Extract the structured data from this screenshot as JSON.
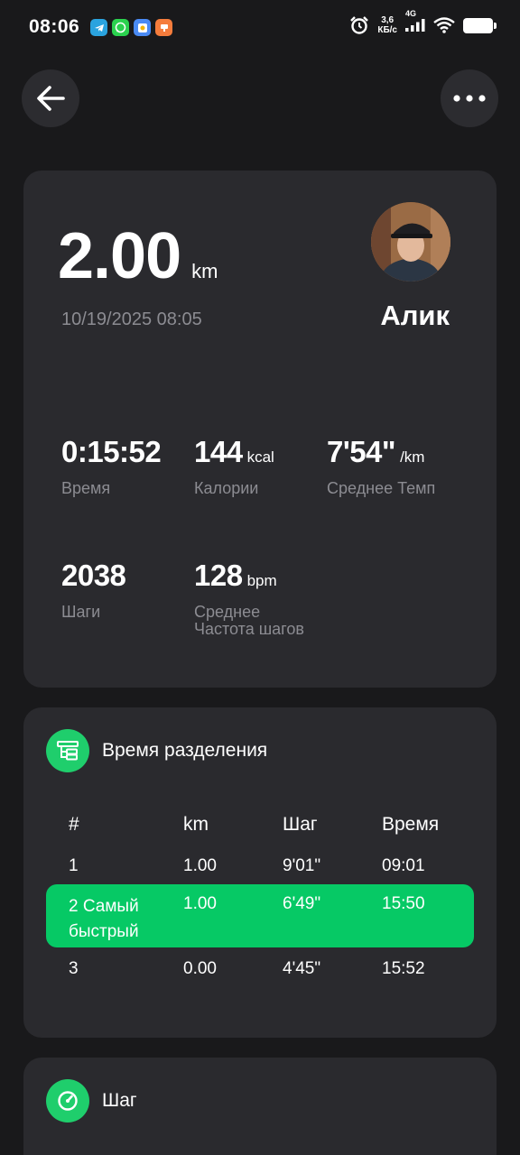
{
  "status_bar": {
    "time": "08:06",
    "net_speed_value": "3,6",
    "net_speed_unit": "КБ/с",
    "network_type": "4G"
  },
  "workout": {
    "distance": "2.00",
    "distance_unit": "km",
    "datetime": "10/19/2025 08:05",
    "user_name": "Алик"
  },
  "stats": {
    "time": {
      "value": "0:15:52",
      "label": "Время"
    },
    "calories": {
      "value": "144",
      "unit": "kcal",
      "label": "Калории"
    },
    "pace": {
      "value": "7'54\"",
      "unit": "/km",
      "label": "Среднее Темп"
    },
    "steps": {
      "value": "2038",
      "label": "Шаги"
    },
    "cadence": {
      "value": "128",
      "unit": "bpm",
      "label_line1": "Среднее",
      "label_line2": "Частота шагов"
    }
  },
  "splits": {
    "title": "Время разделения",
    "headers": [
      "#",
      "km",
      "Шаг",
      "Время"
    ],
    "rows": [
      {
        "num": "1",
        "km": "1.00",
        "pace": "9'01\"",
        "time": "09:01"
      },
      {
        "num": "2  Самый быстрый",
        "km": "1.00",
        "pace": "6'49\"",
        "time": "15:50"
      },
      {
        "num": "3",
        "km": "0.00",
        "pace": "4'45\"",
        "time": "15:52"
      }
    ]
  },
  "pace_section": {
    "title": "Шаг"
  },
  "colors": {
    "accent": "#06c965",
    "card": "#2a2a2e",
    "background": "#19191b"
  }
}
